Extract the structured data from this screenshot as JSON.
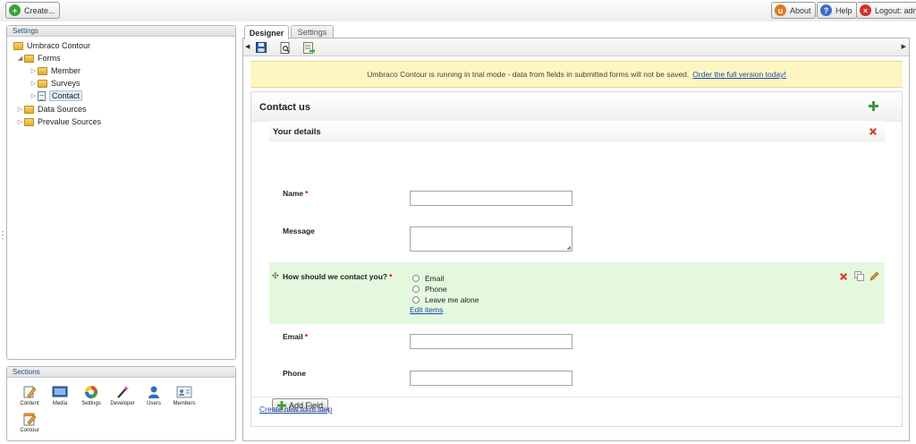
{
  "topbar": {
    "create_label": "Create...",
    "about_label": "About",
    "help_label": "Help",
    "logout_label": "Logout: admin"
  },
  "settings_panel": {
    "title": "Settings",
    "tree": {
      "root": "Umbraco Contour",
      "forms": "Forms",
      "member": "Member",
      "surveys": "Surveys",
      "contact": "Contact",
      "data_sources": "Data Sources",
      "prevalue_sources": "Prevalue Sources"
    }
  },
  "sections_panel": {
    "title": "Sections",
    "items": {
      "content": "Content",
      "media": "Media",
      "settings": "Settings",
      "developer": "Developer",
      "users": "Users",
      "members": "Members",
      "contour": "Contour"
    }
  },
  "tabs": {
    "designer": "Designer",
    "settings": "Settings"
  },
  "notice": {
    "text": "Umbraco Contour is running in trial mode - data from fields in submitted forms will not be saved.",
    "link": "Order the full version today!"
  },
  "form": {
    "title": "Contact us",
    "fieldset": "Your details",
    "fields": {
      "name": "Name",
      "message": "Message",
      "contact_method": "How should we contact you?",
      "email": "Email",
      "phone": "Phone"
    },
    "required_mark": "*",
    "options": {
      "email": "Email",
      "phone": "Phone",
      "leave": "Leave me alone"
    },
    "edit_items": "Edit items",
    "add_field": "Add Field",
    "create_step": "Create new form step"
  },
  "colors": {
    "notice_bg": "#fdf6c3",
    "highlight_bg": "#e3f8dd",
    "link": "#1b4aa5",
    "required": "#cc0000"
  },
  "icons": [
    "plus-circle-icon",
    "about-icon",
    "help-icon",
    "logout-icon",
    "folder-icon",
    "form-icon",
    "save-icon",
    "preview-icon",
    "export-icon",
    "add-fieldset-icon",
    "delete-icon",
    "copy-icon",
    "edit-icon",
    "drag-handle-icon"
  ]
}
